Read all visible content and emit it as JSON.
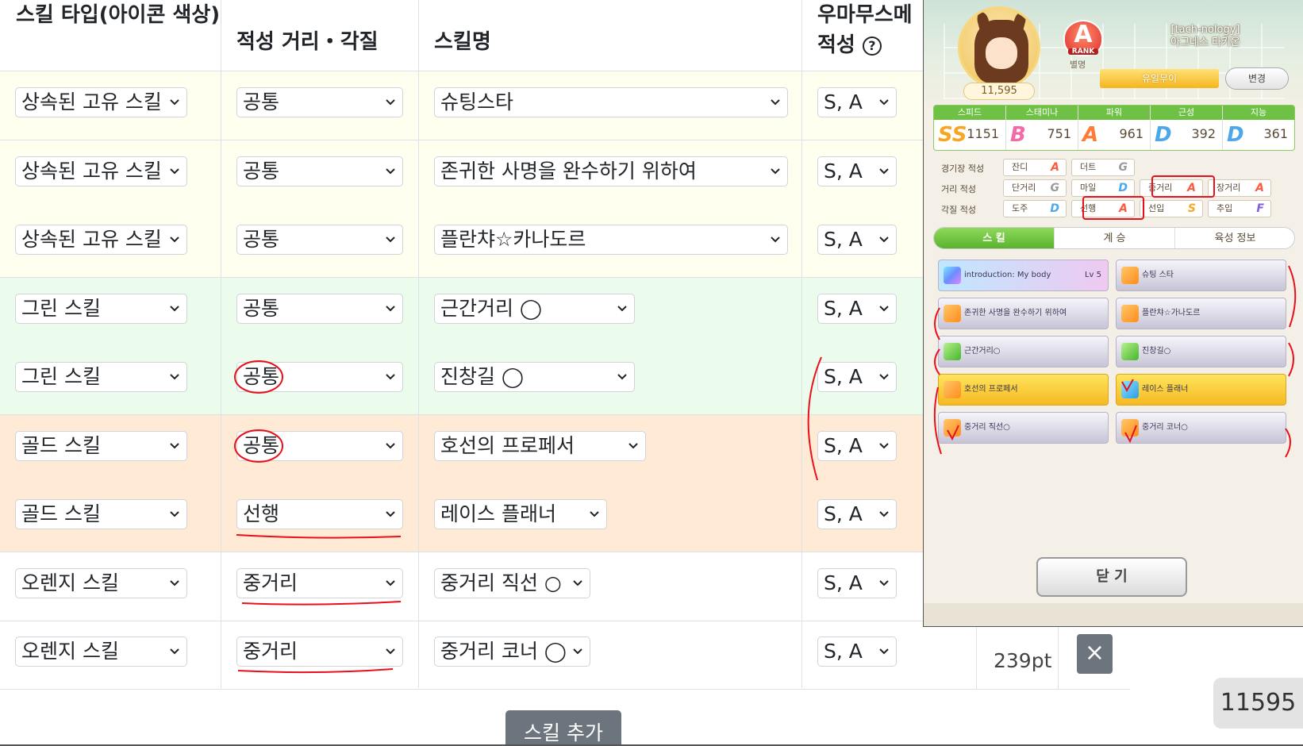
{
  "table": {
    "headers": {
      "skill_type": "스킬 타입(아이콘 색상)",
      "aptitude": "적성 거리・각질",
      "skill_name": "스킬명",
      "umamusume_aptitude": "우마무스메 적성"
    },
    "rows": [
      {
        "type": "상속된 고유 스킬",
        "aptitude": "공통",
        "skill": "슈팅스타",
        "uma": "S, A",
        "bg": "cream"
      },
      {
        "type": "상속된 고유 스킬",
        "aptitude": "공통",
        "skill": "존귀한 사명을 완수하기 위하여",
        "uma": "S, A",
        "bg": "cream"
      },
      {
        "type": "상속된 고유 스킬",
        "aptitude": "공통",
        "skill": "플란챠☆카나도르",
        "uma": "S, A",
        "bg": "cream"
      },
      {
        "type": "그린 스킬",
        "aptitude": "공통",
        "skill": "근간거리 ◯",
        "uma": "S, A",
        "bg": "green"
      },
      {
        "type": "그린 스킬",
        "aptitude": "공통",
        "skill": "진창길 ◯",
        "uma": "S, A",
        "bg": "green"
      },
      {
        "type": "골드 스킬",
        "aptitude": "공통",
        "skill": "호선의 프로페서",
        "uma": "S, A",
        "bg": "peach"
      },
      {
        "type": "골드 스킬",
        "aptitude": "선행",
        "skill": "레이스 플래너",
        "uma": "S, A",
        "bg": "peach"
      },
      {
        "type": "오렌지 스킬",
        "aptitude": "중거리",
        "skill": "중거리 직선 ○",
        "uma": "S, A",
        "bg": "white"
      },
      {
        "type": "오렌지 스킬",
        "aptitude": "중거리",
        "skill": "중거리 코너 ◯",
        "uma": "S, A",
        "bg": "white"
      }
    ],
    "last_row_points": "239pt",
    "delete_label": "×",
    "add_skill_label": "스킬 추가",
    "total_score": "11595"
  },
  "game": {
    "fans": "11,595",
    "rank_letter": "A",
    "rank_word": "RANK",
    "nickname_label": "별명",
    "trainer_line1": "[tach-nology]",
    "trainer_line2": "아그네스 타키온",
    "title_ribbon": "유일무이",
    "change_button": "변경",
    "stats": [
      {
        "name": "스피드",
        "grade": "SS",
        "value": "1151",
        "color": "#f6a623"
      },
      {
        "name": "스태미나",
        "grade": "B",
        "value": "751",
        "color": "#f26ba8"
      },
      {
        "name": "파워",
        "grade": "A",
        "value": "961",
        "color": "#ff7b3a"
      },
      {
        "name": "근성",
        "grade": "D",
        "value": "392",
        "color": "#4ea7e8"
      },
      {
        "name": "지능",
        "grade": "D",
        "value": "361",
        "color": "#4ea7e8"
      }
    ],
    "aptitudes": {
      "track": {
        "label": "경기장 적성",
        "items": [
          {
            "name": "잔디",
            "grade": "A"
          },
          {
            "name": "더트",
            "grade": "G"
          }
        ]
      },
      "distance": {
        "label": "거리 적성",
        "items": [
          {
            "name": "단거리",
            "grade": "G"
          },
          {
            "name": "마일",
            "grade": "D"
          },
          {
            "name": "중거리",
            "grade": "A"
          },
          {
            "name": "장거리",
            "grade": "A"
          }
        ]
      },
      "style": {
        "label": "각질 적성",
        "items": [
          {
            "name": "도주",
            "grade": "D"
          },
          {
            "name": "선행",
            "grade": "A"
          },
          {
            "name": "선입",
            "grade": "S"
          },
          {
            "name": "추입",
            "grade": "F"
          }
        ]
      }
    },
    "tabs": [
      "스 킬",
      "계 승",
      "육성 정보"
    ],
    "skills": [
      {
        "name": "introduction: My body",
        "level": "Lv 5",
        "style": "unique",
        "icon": "rainbow"
      },
      {
        "name": "슈팅 스타",
        "level": "",
        "style": "normal",
        "icon": "orange"
      },
      {
        "name": "존귀한 사명을 완수하기 위하여",
        "level": "",
        "style": "normal",
        "icon": "orange"
      },
      {
        "name": "플란챠☆가나도르",
        "level": "",
        "style": "normal",
        "icon": "orange"
      },
      {
        "name": "근간거리○",
        "level": "",
        "style": "normal",
        "icon": "green"
      },
      {
        "name": "진창길○",
        "level": "",
        "style": "normal",
        "icon": "green"
      },
      {
        "name": "호선의 프로페서",
        "level": "",
        "style": "gold",
        "icon": "orange"
      },
      {
        "name": "레이스 플래너",
        "level": "",
        "style": "gold",
        "icon": "blue"
      },
      {
        "name": "중거리 직선○",
        "level": "",
        "style": "normal",
        "icon": "orange"
      },
      {
        "name": "중거리 코너○",
        "level": "",
        "style": "normal",
        "icon": "orange"
      }
    ],
    "close_button": "닫 기"
  },
  "colors": {
    "annotation_red": "#e8101b",
    "button_gray": "#6c757d",
    "row_cream": "#fffff0",
    "row_green": "#ebfbec",
    "row_peach": "#ffead6"
  }
}
